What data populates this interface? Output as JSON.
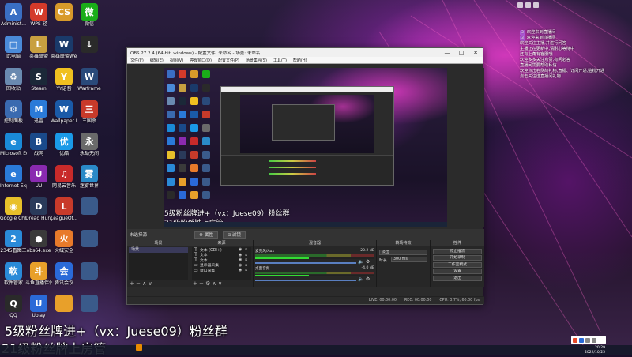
{
  "desktop": {
    "icons": [
      {
        "label": "Administ...",
        "color": "#3a6fc4",
        "glyph": "A"
      },
      {
        "label": "WPS 轻",
        "color": "#d43a2a",
        "glyph": "W"
      },
      {
        "label": "",
        "color": "#d89a2a",
        "glyph": "CS"
      },
      {
        "label": "微信",
        "color": "#1aad19",
        "glyph": "微"
      },
      {
        "label": "此电脑",
        "color": "#4a8ad8",
        "glyph": "□"
      },
      {
        "label": "英雄联盟",
        "color": "#c8a040",
        "glyph": "L"
      },
      {
        "label": "英雄联盟WeGame版",
        "color": "#1a3a6a",
        "glyph": "W"
      },
      {
        "label": "",
        "color": "#2a2a2a",
        "glyph": "↓"
      },
      {
        "label": "回收站",
        "color": "#6a8ab0",
        "glyph": "♻"
      },
      {
        "label": "Steam",
        "color": "#1b2838",
        "glyph": "S"
      },
      {
        "label": "YY语音",
        "color": "#f0c020",
        "glyph": "Y"
      },
      {
        "label": "Warframe",
        "color": "#2a4a7a",
        "glyph": "W"
      },
      {
        "label": "控制面板",
        "color": "#3a6ab0",
        "glyph": "⚙"
      },
      {
        "label": "迅雷",
        "color": "#2a7ad8",
        "glyph": "M"
      },
      {
        "label": "Wallpaper Engine",
        "color": "#1a5aa8",
        "glyph": "W"
      },
      {
        "label": "三国杀",
        "color": "#c83a2a",
        "glyph": "三"
      },
      {
        "label": "Microsoft Edge",
        "color": "#1a8ad8",
        "glyph": "e"
      },
      {
        "label": "战网",
        "color": "#1a4a8a",
        "glyph": "B"
      },
      {
        "label": "优酷",
        "color": "#1a9ae8",
        "glyph": "优"
      },
      {
        "label": "永劫无间",
        "color": "#6a6a6a",
        "glyph": "永"
      },
      {
        "label": "Internet Explorer",
        "color": "#2a7ad8",
        "glyph": "e"
      },
      {
        "label": "UU",
        "color": "#8a2ab0",
        "glyph": "U"
      },
      {
        "label": "网易云音乐",
        "color": "#c82a2a",
        "glyph": "♫"
      },
      {
        "label": "迷雾世界",
        "color": "#2a8ac8",
        "glyph": "雾"
      },
      {
        "label": "Google Chrome",
        "color": "#e8c02a",
        "glyph": "◉"
      },
      {
        "label": "Dread Hunger",
        "color": "#2a3a5a",
        "glyph": "D"
      },
      {
        "label": "LeagueOf...",
        "color": "#c83a2a",
        "glyph": "L"
      },
      {
        "label": "",
        "color": "#3a5a8a",
        "glyph": ""
      },
      {
        "label": "2345看图王",
        "color": "#2a8ad8",
        "glyph": "2"
      },
      {
        "label": "obs64.exe",
        "color": "#3a3a3a",
        "glyph": "●"
      },
      {
        "label": "火绒安全",
        "color": "#e87a2a",
        "glyph": "火"
      },
      {
        "label": "",
        "color": "#3a5a8a",
        "glyph": ""
      },
      {
        "label": "软件管家",
        "color": "#2a8ad8",
        "glyph": "软"
      },
      {
        "label": "斗鱼直播伴侣",
        "color": "#e8a02a",
        "glyph": "斗"
      },
      {
        "label": "腾讯会议",
        "color": "#2a6ad8",
        "glyph": "会"
      },
      {
        "label": "",
        "color": "#3a5a8a",
        "glyph": ""
      },
      {
        "label": "QQ",
        "color": "#2a2a2a",
        "glyph": "Q"
      },
      {
        "label": "Uplay",
        "color": "#2a6ad8",
        "glyph": "U"
      },
      {
        "label": "",
        "color": "#e8a02a",
        "glyph": ""
      },
      {
        "label": "",
        "color": "#3a5a8a",
        "glyph": ""
      }
    ]
  },
  "obs": {
    "title": "OBS 27.2.4 (64-bit, windows) - 配置文件: 未命名 - 场景: 未命名",
    "window_controls": [
      "—",
      "□",
      "✕"
    ],
    "menu": [
      "文件(F)",
      "编辑(E)",
      "视图(V)",
      "停靠窗口(D)",
      "配置文件(P)",
      "场景集合(S)",
      "工具(T)",
      "帮助(H)"
    ],
    "preview_caption1": "5级粉丝牌进+（vx：Juese09）粉丝群",
    "preview_caption2": "21级粉丝牌上房管",
    "scene_label": "未选择源",
    "scene_buttons": [
      "⚙ 属性",
      "⊞ 滤镜"
    ],
    "docks": {
      "scenes": {
        "header": "场景",
        "items": [
          "场景"
        ],
        "footer": "+ − ∧ ∨"
      },
      "sources": {
        "header": "来源",
        "items": [
          {
            "type": "T",
            "name": "文本 (GDI+)"
          },
          {
            "type": "T",
            "name": "文本"
          },
          {
            "type": "T",
            "name": "文本"
          },
          {
            "type": "▭",
            "name": "显示器采集"
          },
          {
            "type": "▭",
            "name": "窗口采集"
          }
        ],
        "footer": "+ − ⚙ ∧ ∨"
      },
      "mixer": {
        "header": "混音器",
        "tracks": [
          {
            "name": "麦克风/Aux",
            "level": "-20.2 dB"
          },
          {
            "name": "桌面音频",
            "level": "-4.0 dB"
          }
        ]
      },
      "transitions": {
        "header": "转场特效",
        "mode": "淡出",
        "duration_label": "时长",
        "duration": "300 ms"
      },
      "controls": {
        "header": "控件",
        "buttons": [
          "停止推流",
          "开始录制",
          "工作室模式",
          "设置",
          "退出"
        ]
      }
    },
    "status": [
      "LIVE: 00:00:00",
      "REC: 00:00:00",
      "CPU: 3.7%, 60.00 fps"
    ]
  },
  "chat": {
    "lines": [
      {
        "badge": "",
        "text": ""
      },
      {
        "badge": "3",
        "text": "欢迎来到直播间"
      },
      {
        "badge": "3",
        "text": "欢迎来到直播间"
      },
      {
        "badge": "",
        "text": "欢迎关注主播,并进行问答"
      },
      {
        "badge": "",
        "text": "主播正在更新中,请耐心等待中"
      },
      {
        "badge": "",
        "text": "还有上角有客服哦"
      },
      {
        "badge": "",
        "text": "欢迎多多关注点赞,有问必答"
      },
      {
        "badge": "",
        "text": "直播间需要帮助私信"
      },
      {
        "badge": "",
        "text": ""
      },
      {
        "badge": "",
        "text": "欢迎点击右侧的礼物,直播、订阅开通,贴粉开通"
      },
      {
        "badge": "",
        "text": "点击关注送直播间礼物"
      }
    ]
  },
  "desktop_captions": {
    "line1": "5级粉丝牌进+（vx：Juese09）粉丝群",
    "line2": "21级粉丝牌上房管"
  },
  "taskbar": {
    "time": "20:29",
    "date": "2022/10/25"
  }
}
